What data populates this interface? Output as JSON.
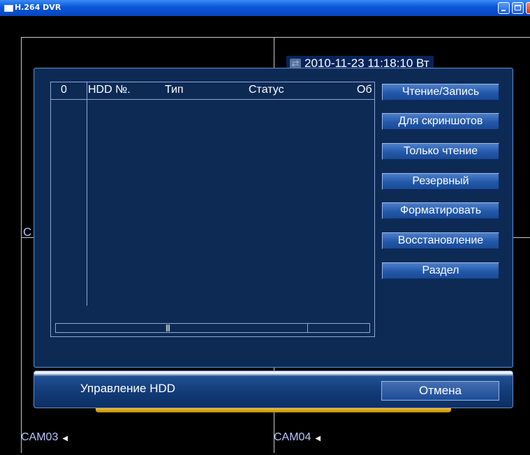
{
  "window": {
    "title": "H.264 DVR"
  },
  "overlay": {
    "datetime": "2010-11-23 11:18:10 Вт",
    "cam_c_letter": "C",
    "cam03": "CAM03",
    "cam04": "CAM04"
  },
  "table": {
    "headers": [
      "0",
      "HDD №.",
      "Тип",
      "Статус",
      "Об"
    ]
  },
  "side_buttons": [
    "Чтение/Запись",
    "Для скриншотов",
    "Только чтение",
    "Резервный",
    "Форматировать",
    "Восстановление",
    "Раздел"
  ],
  "bottom": {
    "title": "Управление HDD",
    "cancel": "Отмена"
  }
}
